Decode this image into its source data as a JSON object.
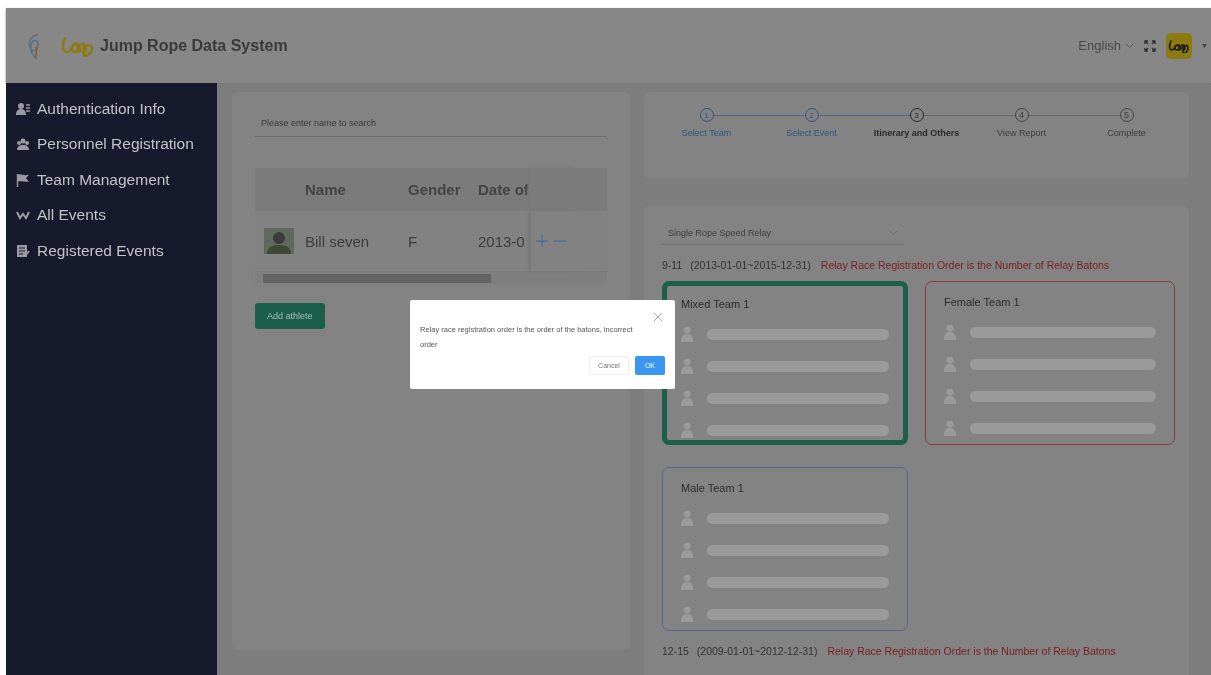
{
  "header": {
    "title": "Jump Rope Data System",
    "language": "English"
  },
  "sidebar": {
    "items": [
      {
        "label": "Authentication Info"
      },
      {
        "label": "Personnel Registration"
      },
      {
        "label": "Team Management"
      },
      {
        "label": "All Events"
      },
      {
        "label": "Registered Events"
      }
    ]
  },
  "athletes": {
    "search": {
      "placeholder": "Please enter name to search"
    },
    "table": {
      "columns": [
        "Name",
        "Gender",
        "Date of"
      ],
      "rows": [
        {
          "name": "Bill seven",
          "gender": "F",
          "date": "2013-0"
        }
      ]
    },
    "add_button": "Add athlete"
  },
  "steps": [
    {
      "number": "1",
      "label": "Select Team",
      "done": true,
      "active": false
    },
    {
      "number": "2",
      "label": "Select Event",
      "done": true,
      "active": false
    },
    {
      "number": "3",
      "label": "Itinerary and Others",
      "done": false,
      "active": true
    },
    {
      "number": "4",
      "label": "View Report",
      "done": false,
      "active": false
    },
    {
      "number": "5",
      "label": "Complete",
      "done": false,
      "active": false
    }
  ],
  "event": {
    "value": "Single Rope Speed Relay",
    "groups": [
      {
        "age": "9-11",
        "range": "(2013-01-01~2015-12-31)",
        "note": "Relay Race Registration Order is the Number of Relay Batons",
        "teams": [
          {
            "name": "Mixed Team 1",
            "selected": true,
            "color": "#1d5f4a"
          },
          {
            "name": "Female Team 1",
            "selected": false,
            "color": "#8a3c3c"
          },
          {
            "name": "Male Team 1",
            "selected": false,
            "color": "#5e6394"
          }
        ]
      },
      {
        "age": "12-15",
        "range": "(2009-01-01~2012-12-31)",
        "note": "Relay Race Registration Order is the Number of Relay Batons"
      }
    ]
  },
  "dialog": {
    "message": "Relay race registration order is the order of the batons, incorrect order",
    "cancel": "Cancel",
    "ok": "OK"
  }
}
